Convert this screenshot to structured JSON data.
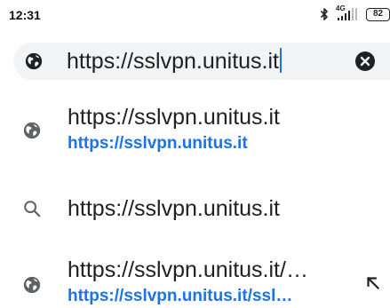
{
  "status_bar": {
    "time": "12:31",
    "network_label": "4G",
    "battery": "82"
  },
  "omnibox": {
    "value": "https://sslvpn.unitus.it",
    "leading_icon": "globe-icon",
    "clear_icon": "clear-icon"
  },
  "suggestions": [
    {
      "icon": "globe-icon",
      "title": "https://sslvpn.unitus.it",
      "url": "https://sslvpn.unitus.it"
    },
    {
      "icon": "search-icon",
      "title": "https://sslvpn.unitus.it"
    },
    {
      "icon": "globe-icon",
      "title": "https://sslvpn.unitus.it/…",
      "url_bold": "https://sslvpn.unitus.it",
      "url_rest": "/ssl…",
      "action_icon": "arrow-up-left-icon"
    }
  ],
  "colors": {
    "accent": "#1a73e8",
    "omnibox_bg": "#f1f3f4",
    "text": "#202124",
    "icon_gray": "#5f6368"
  }
}
